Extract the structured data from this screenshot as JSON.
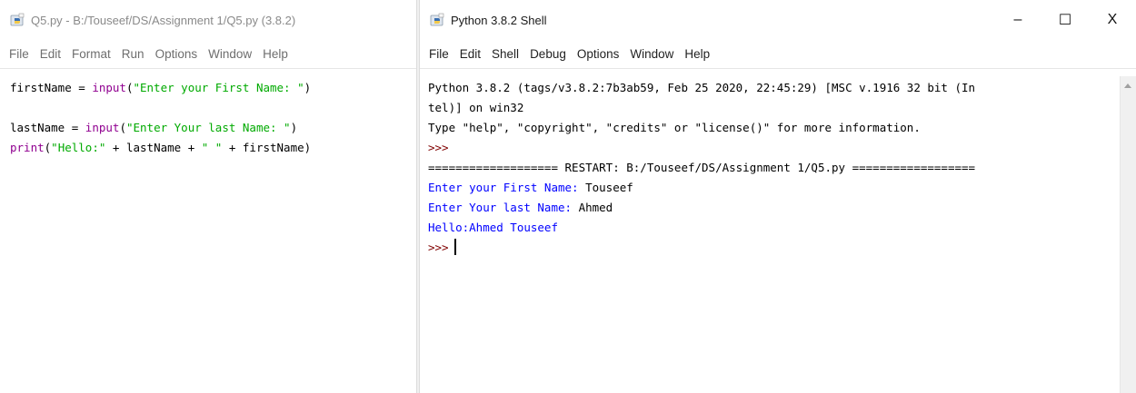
{
  "editor": {
    "title": "Q5.py - B:/Touseef/DS/Assignment 1/Q5.py (3.8.2)",
    "menu": [
      "File",
      "Edit",
      "Format",
      "Run",
      "Options",
      "Window",
      "Help"
    ],
    "code": {
      "line1": {
        "before": "firstName = ",
        "kw": "input",
        "open": "(",
        "str": "\"Enter your First Name: \"",
        "close": ")"
      },
      "line3": {
        "before": "lastName = ",
        "kw": "input",
        "open": "(",
        "str": "\"Enter Your last Name: \"",
        "close": ")"
      },
      "line4": {
        "kw": "print",
        "open": "(",
        "str": "\"Hello:\"",
        "mid": " + lastName + ",
        "str2": "\" \"",
        "end": " + firstName)"
      }
    }
  },
  "shell": {
    "title": "Python 3.8.2 Shell",
    "controls": {
      "minimize": "–",
      "maximize": "☐",
      "close": "X"
    },
    "menu": [
      "File",
      "Edit",
      "Shell",
      "Debug",
      "Options",
      "Window",
      "Help"
    ],
    "lines": {
      "banner1": "Python 3.8.2 (tags/v3.8.2:7b3ab59, Feb 25 2020, 22:45:29) [MSC v.1916 32 bit (In",
      "banner2": "tel)] on win32",
      "banner3": "Type \"help\", \"copyright\", \"credits\" or \"license()\" for more information.",
      "prompt1": ">>>",
      "restart": "=================== RESTART: B:/Touseef/DS/Assignment 1/Q5.py ==================",
      "q1": "Enter your First Name: ",
      "a1": "Touseef",
      "q2": "Enter Your last Name: ",
      "a2": "Ahmed",
      "out": "Hello:Ahmed Touseef",
      "prompt2": ">>>"
    }
  },
  "colors": {
    "keyword": "#900090",
    "string": "#00aa00",
    "stdout": "#0000ff",
    "prompt": "#800000"
  },
  "icons": {
    "editor_title_icon": "python-idle-icon",
    "shell_title_icon": "python-idle-icon"
  }
}
